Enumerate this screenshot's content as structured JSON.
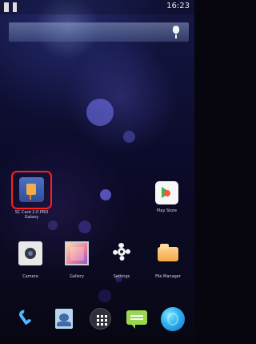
{
  "status_bar": {
    "time": "16:23"
  },
  "home_screen": {
    "featured_app": {
      "label_line1": "SC Card 2.0 PRO",
      "label_line2": "Galaxy"
    },
    "play_store_label": "Play Store",
    "row_apps": [
      {
        "label": "Camera"
      },
      {
        "label": "Gallery"
      },
      {
        "label": "Settings"
      },
      {
        "label": "File Manager"
      }
    ]
  },
  "dock": {
    "apps": [
      "phone-icon",
      "contacts-icon",
      "all-apps-icon",
      "messaging-icon",
      "browser-icon"
    ]
  },
  "colors": {
    "highlight": "#ff1f1f",
    "search_bar": "#6f7cb0",
    "background": "#0b0b2b"
  }
}
